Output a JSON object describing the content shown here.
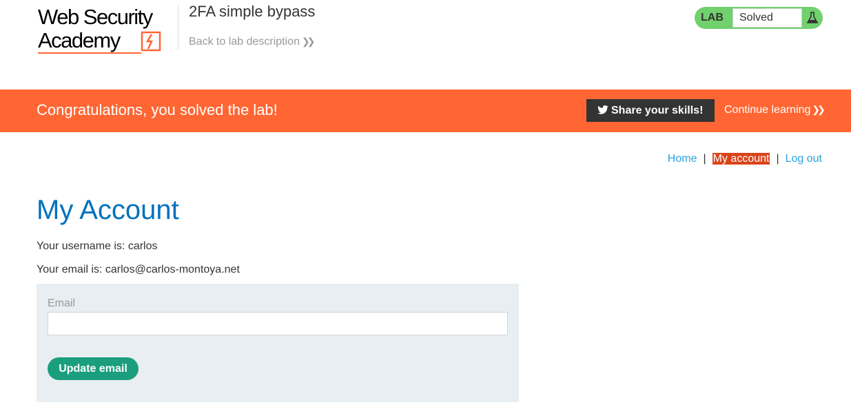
{
  "header": {
    "logo_line1": "Web Security",
    "logo_line2": "Academy",
    "lab_title": "2FA simple bypass",
    "back_link": "Back to lab description",
    "lab_tag": "LAB",
    "lab_status": "Solved"
  },
  "banner": {
    "message": "Congratulations, you solved the lab!",
    "share_label": "Share your skills!",
    "continue_label": "Continue learning"
  },
  "nav": {
    "home": "Home",
    "separator": "|",
    "my_account": "My account",
    "log_out": "Log out"
  },
  "main": {
    "title": "My Account",
    "username_text": "Your username is: carlos",
    "email_text": "Your email is: carlos@carlos-montoya.net"
  },
  "form": {
    "email_label": "Email",
    "email_value": "",
    "update_label": "Update email"
  },
  "colors": {
    "accent": "#ff6633",
    "link": "#29a2dc",
    "title": "#0071bc",
    "active_nav": "#d9441b",
    "status_green": "#70d16d",
    "button_green": "#1a9e7e"
  },
  "icons": {
    "logo_mark": "lightning-bolt-icon",
    "flask": "flask-icon",
    "twitter": "twitter-icon",
    "chevron": "double-chevron-right-icon"
  }
}
